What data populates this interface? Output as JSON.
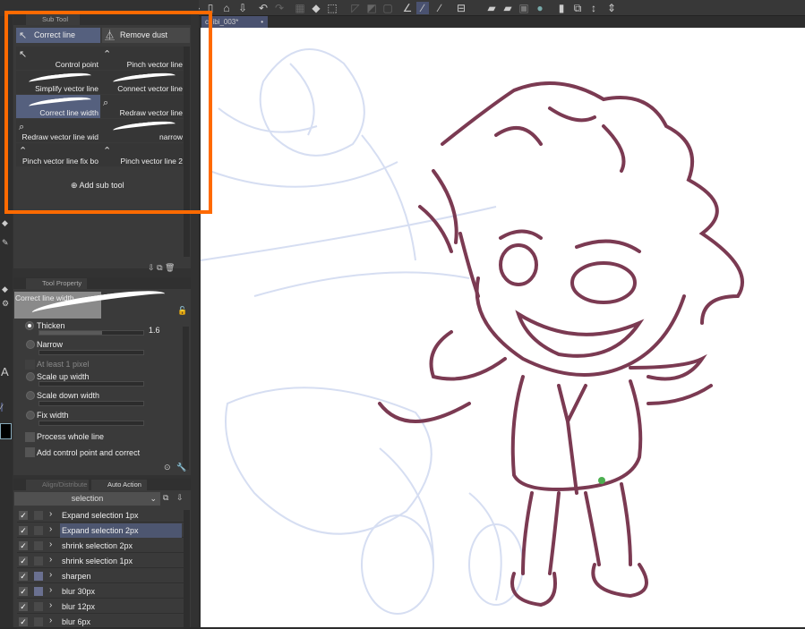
{
  "document": {
    "tab_title": "chibi_003*"
  },
  "subtool": {
    "title": "Sub Tool",
    "groups": [
      "Correct line",
      "Remove dust"
    ],
    "items": [
      "Control point",
      "Pinch vector line",
      "Simplify vector line",
      "Connect vector line",
      "Correct line width",
      "Redraw vector line",
      "Redraw vector line wid",
      "narrow",
      "Pinch vector line fix bo",
      "Pinch vector line 2"
    ],
    "selected": "Correct line width",
    "add_label": "Add sub tool"
  },
  "tool_property": {
    "title": "Tool Property",
    "preview_name": "Correct line width",
    "thicken": "Thicken",
    "thicken_value": "1.6",
    "narrow": "Narrow",
    "at_least": "At least 1 pixel",
    "scale_up": "Scale up width",
    "scale_down": "Scale down width",
    "fix_width": "Fix width",
    "process_whole": "Process whole line",
    "add_control": "Add control point and correct",
    "selected_mode": "Thicken",
    "thicken_fraction": 0.6
  },
  "auto_action": {
    "tabs": [
      "Align/Distribute",
      "Auto Action"
    ],
    "set": "selection",
    "items": [
      {
        "label": "Expand selection 1px",
        "icon": false
      },
      {
        "label": "Expand selection 2px",
        "icon": false,
        "selected": true
      },
      {
        "label": "shrink selection 2px",
        "icon": false
      },
      {
        "label": "shrink selection 1px",
        "icon": false
      },
      {
        "label": "sharpen",
        "icon": true
      },
      {
        "label": "blur 30px",
        "icon": true
      },
      {
        "label": "blur 12px",
        "icon": false
      },
      {
        "label": "blur 6px",
        "icon": false
      }
    ]
  },
  "colors": {
    "highlight": "#ff6a00",
    "line": "#7b3a52",
    "sketch": "#d6def2",
    "accent": "#55607e"
  }
}
